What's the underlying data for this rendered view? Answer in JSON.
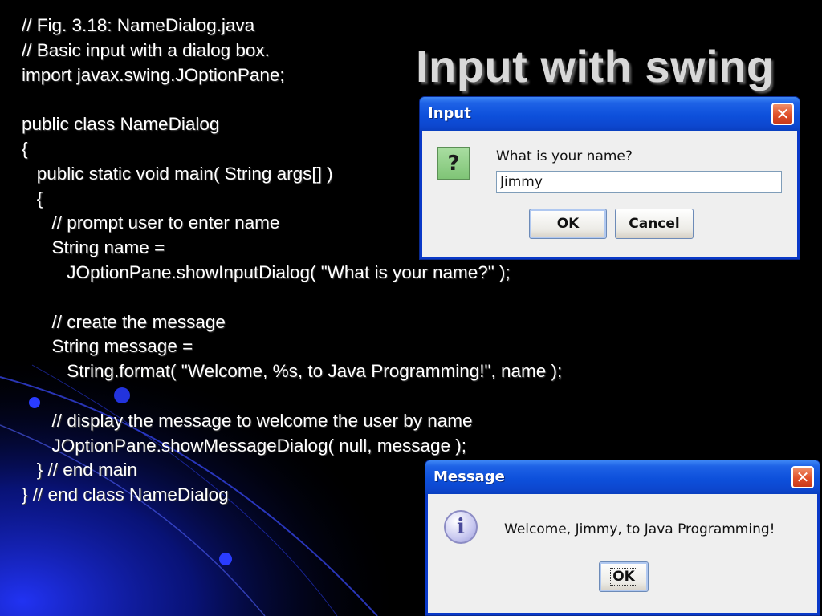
{
  "slide": {
    "title": "Input with swing",
    "code_lines": [
      "// Fig. 3.18: NameDialog.java",
      "// Basic input with a dialog box.",
      "import javax.swing.JOptionPane;",
      "",
      "public class NameDialog",
      "{",
      "   public static void main( String args[] )",
      "   {",
      "      // prompt user to enter name",
      "      String name =",
      "         JOptionPane.showInputDialog( \"What is your name?\" );",
      "",
      "      // create the message",
      "      String message =",
      "         String.format( \"Welcome, %s, to Java Programming!\", name );",
      "",
      "      // display the message to welcome the user by name",
      "      JOptionPane.showMessageDialog( null, message );",
      "   } // end main",
      "} // end class NameDialog"
    ]
  },
  "input_dialog": {
    "title": "Input",
    "close_glyph": "✕",
    "icon": "question-icon",
    "icon_glyph": "?",
    "prompt": "What is your name?",
    "field_value": "Jimmy",
    "ok_label": "OK",
    "cancel_label": "Cancel"
  },
  "message_dialog": {
    "title": "Message",
    "close_glyph": "✕",
    "icon": "info-icon",
    "icon_glyph": "i",
    "message": "Welcome, Jimmy, to Java Programming!",
    "ok_label": "OK"
  },
  "colors": {
    "background": "#000000",
    "accent_blue": "#1a2fd8",
    "titlebar_blue": "#0d50db",
    "dialog_body": "#efefef",
    "close_red": "#e0502a"
  }
}
